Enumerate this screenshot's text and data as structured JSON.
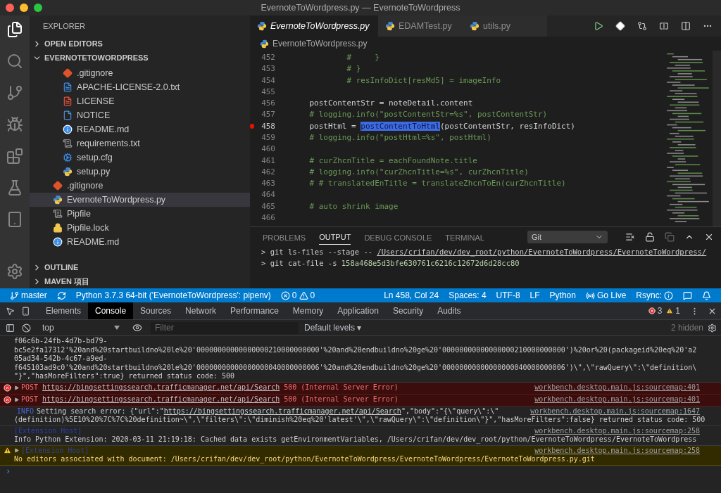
{
  "window": {
    "title": "EvernoteToWordpress.py — EvernoteToWordpress"
  },
  "sidebar": {
    "title": "EXPLORER",
    "sections": [
      {
        "label": "OPEN EDITORS",
        "expanded": false
      },
      {
        "label": "EVERNOTETOWORDPRESS",
        "expanded": true,
        "items": [
          {
            "kind": "folder-contents",
            "children": [
              {
                "label": ".gitignore",
                "kind": "git",
                "selected": false
              },
              {
                "label": "APACHE-LICENSE-2.0.txt",
                "kind": "text",
                "selected": false
              },
              {
                "label": "LICENSE",
                "kind": "license",
                "selected": false
              },
              {
                "label": "NOTICE",
                "kind": "file",
                "selected": false
              },
              {
                "label": "README.md",
                "kind": "info",
                "selected": false
              },
              {
                "label": "requirements.txt",
                "kind": "list",
                "selected": false
              },
              {
                "label": "setup.cfg",
                "kind": "config",
                "selected": false
              },
              {
                "label": "setup.py",
                "kind": "python",
                "selected": false
              }
            ]
          },
          {
            "label": ".gitignore",
            "kind": "git",
            "selected": false
          },
          {
            "label": "EvernoteToWordpress.py",
            "kind": "python",
            "selected": true
          },
          {
            "label": "Pipfile",
            "kind": "list",
            "selected": false
          },
          {
            "label": "Pipfile.lock",
            "kind": "lock",
            "selected": false
          },
          {
            "label": "README.md",
            "kind": "info",
            "selected": false
          }
        ]
      }
    ],
    "bottom_sections": [
      {
        "label": "OUTLINE",
        "expanded": false
      },
      {
        "label": "MAVEN 項目",
        "expanded": false
      }
    ]
  },
  "editor": {
    "tabs": [
      {
        "label": "EvernoteToWordpress.py",
        "selected": true
      },
      {
        "label": "EDAMTest.py",
        "selected": false
      },
      {
        "label": "utils.py",
        "selected": false
      }
    ],
    "breadcrumb": "EvernoteToWordpress.py",
    "lines": [
      {
        "number": "452",
        "breakpoint": false,
        "segments": [
          {
            "text": "            #     }",
            "kind": "comment"
          }
        ]
      },
      {
        "number": "453",
        "breakpoint": false,
        "segments": [
          {
            "text": "            # }",
            "kind": "comment"
          }
        ]
      },
      {
        "number": "454",
        "breakpoint": false,
        "segments": [
          {
            "text": "            # resInfoDict[resMd5] = imageInfo",
            "kind": "comment"
          }
        ]
      },
      {
        "number": "455",
        "breakpoint": false
      },
      {
        "number": "456",
        "breakpoint": false,
        "segments": [
          {
            "text": "    postContentStr = noteDetail.content",
            "kind": "plain"
          }
        ]
      },
      {
        "number": "457",
        "breakpoint": false,
        "segments": [
          {
            "text": "    # logging.info(\"postContentStr=%s\", postContentStr)",
            "kind": "comment"
          }
        ]
      },
      {
        "number": "458",
        "breakpoint": true,
        "segments": [
          {
            "text": "    postHtml = ",
            "kind": "plain"
          },
          {
            "text": "postContentToHtml",
            "kind": "highlight"
          },
          {
            "text": "(postContentStr, resInfoDict)",
            "kind": "plain"
          }
        ]
      },
      {
        "number": "459",
        "breakpoint": false,
        "segments": [
          {
            "text": "    # logging.info(\"postHtml=%s\", postHtml)",
            "kind": "comment"
          }
        ]
      },
      {
        "number": "460",
        "breakpoint": false
      },
      {
        "number": "461",
        "breakpoint": false,
        "segments": [
          {
            "text": "    # curZhcnTitle = eachFoundNote.title",
            "kind": "comment"
          }
        ]
      },
      {
        "number": "462",
        "breakpoint": false,
        "segments": [
          {
            "text": "    # logging.info(\"curZhcnTitle=%s\", curZhcnTitle)",
            "kind": "comment"
          }
        ]
      },
      {
        "number": "463",
        "breakpoint": false,
        "segments": [
          {
            "text": "    # # translatedEnTitle = translateZhcnToEn(curZhcnTitle)",
            "kind": "comment"
          }
        ]
      },
      {
        "number": "464",
        "breakpoint": false
      },
      {
        "number": "465",
        "breakpoint": false,
        "segments": [
          {
            "text": "    # auto shrink image",
            "kind": "comment"
          }
        ]
      },
      {
        "number": "466",
        "breakpoint": false
      }
    ]
  },
  "panel": {
    "tabs": [
      {
        "label": "PROBLEMS",
        "selected": false
      },
      {
        "label": "OUTPUT",
        "selected": true
      },
      {
        "label": "DEBUG CONSOLE",
        "selected": false
      },
      {
        "label": "TERMINAL",
        "selected": false
      }
    ],
    "channel": "Git",
    "lines": [
      {
        "command": "> git ls-files --stage -- ",
        "argument": "/Users/crifan/dev/dev_root/python/EvernoteToWordpress/EvernoteToWordpress/",
        "kind": "path"
      },
      {
        "command": "> git cat-file -s ",
        "argument": "158a468e5d3bfe630761c6216c12672d6d28cc80",
        "kind": "hash"
      }
    ]
  },
  "status_bar": {
    "left": [
      {
        "kind": "branch",
        "text": "master"
      },
      {
        "kind": "sync"
      },
      {
        "kind": "text",
        "text": "Python 3.7.3 64-bit ('EvernoteToWordpress': pipenv)"
      },
      {
        "kind": "problems",
        "errors": "0",
        "warnings": "0"
      }
    ],
    "right": [
      {
        "kind": "text",
        "text": "Ln 458, Col 24"
      },
      {
        "kind": "text",
        "text": "Spaces: 4"
      },
      {
        "kind": "text",
        "text": "UTF-8"
      },
      {
        "kind": "text",
        "text": "LF"
      },
      {
        "kind": "text",
        "text": "Python"
      },
      {
        "kind": "live",
        "text": "Go Live"
      },
      {
        "kind": "rsync",
        "text": "Rsync:"
      },
      {
        "kind": "feedback"
      },
      {
        "kind": "bell"
      }
    ]
  },
  "devtools": {
    "tabs": [
      {
        "label": "Elements",
        "selected": false
      },
      {
        "label": "Console",
        "selected": true
      },
      {
        "label": "Sources",
        "selected": false
      },
      {
        "label": "Network",
        "selected": false
      },
      {
        "label": "Performance",
        "selected": false
      },
      {
        "label": "Memory",
        "selected": false
      },
      {
        "label": "Application",
        "selected": false
      },
      {
        "label": "Security",
        "selected": false
      },
      {
        "label": "Audits",
        "selected": false
      }
    ],
    "error_count": "3",
    "warning_count": "1",
    "context": "top",
    "filter": {
      "placeholder": "Filter"
    },
    "levels": "Default levels ▾",
    "hidden": "2 hidden",
    "messages": [
      {
        "kind": "plain",
        "lines": [
          "f06c6b-24fb-4d7b-bd79-",
          "bc5e2fa17312'%20and%20startbuildno%20le%20'00000000000000000210000000000'%20and%20endbuildno%20ge%20'00000000000000000210000000000')%20or%20(packageid%20eq%20'a2",
          "05ad34-542b-4c67-a9ed-",
          "f645103ad9c0'%20and%20startbuildno%20le%20'00000000000000000040000000006'%20and%20endbuildno%20ge%20'00000000000000000040000000006')\\\",\\\"rawQuery\\\":\\\"definition\\",
          "\"}\",\"hasMoreFilters\":true} returned status code: 500"
        ]
      },
      {
        "kind": "error",
        "method": "POST",
        "url": "https://bingsettingssearch.trafficmanager.net/api/Search",
        "text": "500 (Internal Server Error)",
        "source": "workbench.desktop.main.js:sourcemap:401"
      },
      {
        "kind": "error",
        "method": "POST",
        "url": "https://bingsettingssearch.trafficmanager.net/api/Search",
        "text": "500 (Internal Server Error)",
        "source": "workbench.desktop.main.js:sourcemap:401"
      },
      {
        "kind": "info",
        "badge": "INFO",
        "before": "Setting search error: {\"url\":\"",
        "url": "https://bingsettingssearch.trafficmanager.net/api/Search",
        "after": "\",\"body\":\"{\\\"query\\\":\\\"",
        "continuation": "(definition)%5E10%20%7C%7C%20definition~\\\",\\\"filters\\\":\\\"diminish%20eq%20'latest'\\\",\\\"rawQuery\\\":\\\"definition\\\"}\",\"hasMoreFilters\":false} returned status code: 500",
        "source": "workbench.desktop.main.js:sourcemap:1647"
      },
      {
        "kind": "extension",
        "badge": "[Extension Host]",
        "continuation": "Info Python Extension: 2020-03-11 21:19:18: Cached data exists getEnvironmentVariables, /Users/crifan/dev/dev_root/python/EvernoteToWordpress/EvernoteToWordpress",
        "source": "workbench.desktop.main.js:sourcemap:258"
      },
      {
        "kind": "warning",
        "badge": "[Extension Host]",
        "continuation": "No editors associated with document: /Users/crifan/dev/dev_root/python/EvernoteToWordpress/EvernoteToWordpress/EvernoteToWordpress.py.git",
        "source": "workbench.desktop.main.js:sourcemap:258"
      }
    ],
    "prompt": "›"
  }
}
